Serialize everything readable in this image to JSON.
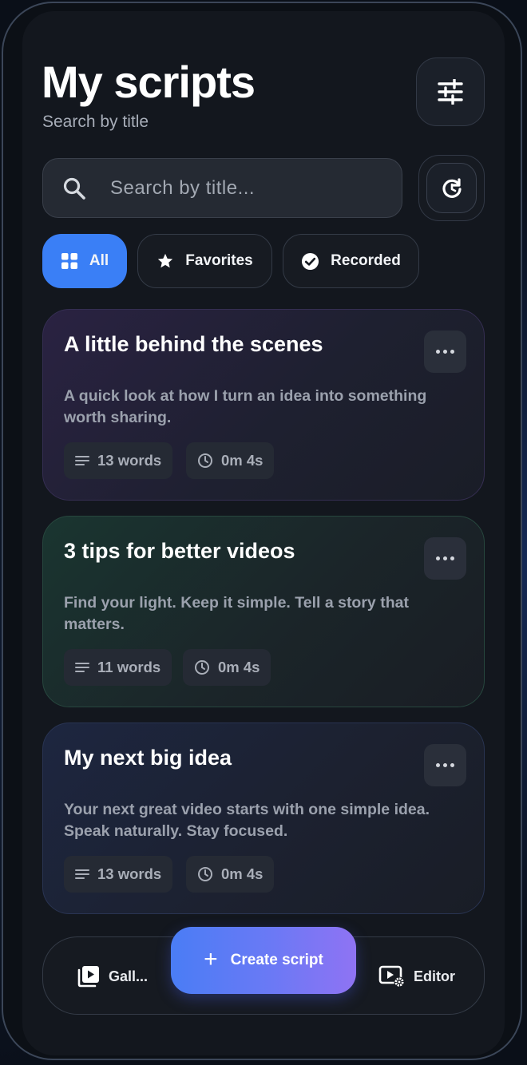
{
  "header": {
    "title": "My scripts",
    "subtitle": "Search by title"
  },
  "search": {
    "placeholder": "Search by title...",
    "value": ""
  },
  "filters": [
    {
      "label": "All",
      "icon": "grid-icon",
      "active": true
    },
    {
      "label": "Favorites",
      "icon": "star-icon",
      "active": false
    },
    {
      "label": "Recorded",
      "icon": "check-circle-icon",
      "active": false
    }
  ],
  "scripts": [
    {
      "title": "A little behind the scenes",
      "description": "A quick look at how I turn an idea into something worth sharing.",
      "words": "13 words",
      "duration": "0m 4s"
    },
    {
      "title": "3 tips for better videos",
      "description": "Find your light. Keep it simple. Tell a story that matters.",
      "words": "11 words",
      "duration": "0m 4s"
    },
    {
      "title": "My next big idea",
      "description": "Your next great video starts with one simple idea. Speak naturally. Stay focused.",
      "words": "13 words",
      "duration": "0m 4s"
    }
  ],
  "bottom_nav": {
    "gallery_label": "Gall...",
    "create_label": "Create script",
    "editor_label": "Editor"
  },
  "colors": {
    "accent": "#3a7ff6",
    "create_gradient_start": "#4a7df5",
    "create_gradient_end": "#8f73f3"
  }
}
